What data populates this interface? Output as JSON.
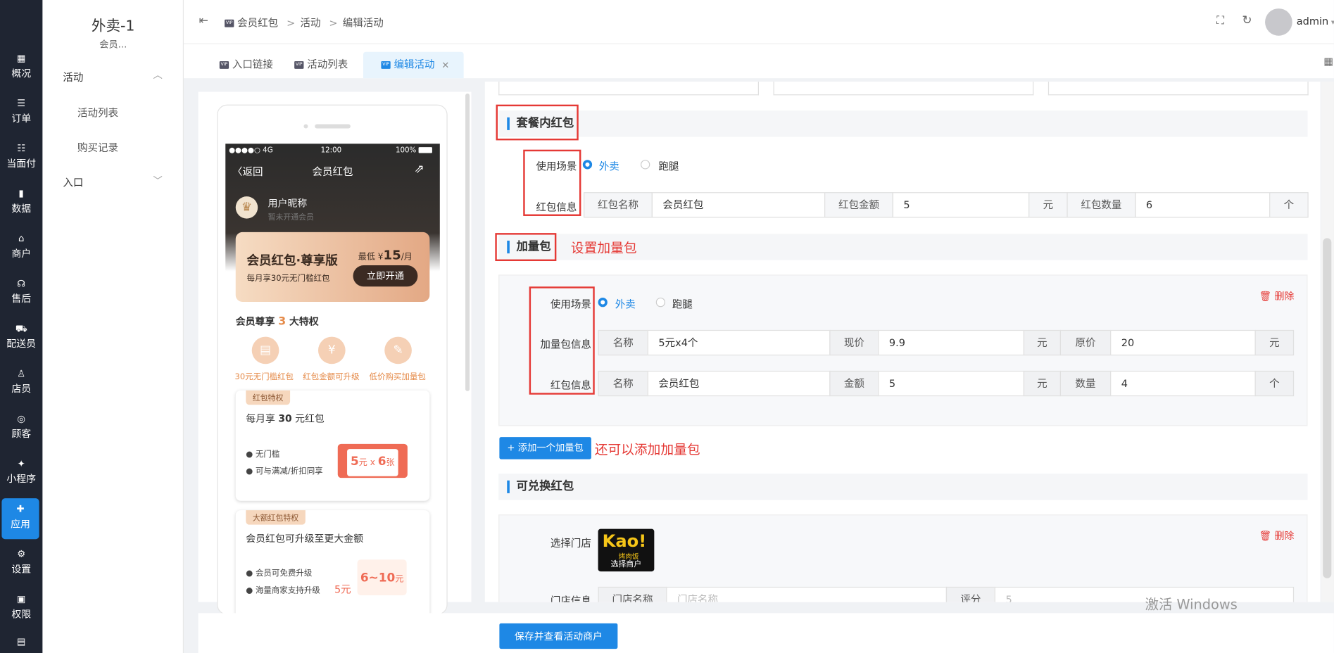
{
  "app": {
    "title": "外卖-1",
    "subtitle": "会员..."
  },
  "rail": [
    {
      "label": "概况",
      "icon": "▦"
    },
    {
      "label": "订单",
      "icon": "☰"
    },
    {
      "label": "当面付",
      "icon": "☷"
    },
    {
      "label": "数据",
      "icon": "▮"
    },
    {
      "label": "商户",
      "icon": "⌂"
    },
    {
      "label": "售后",
      "icon": "☊"
    },
    {
      "label": "配送员",
      "icon": "⛟"
    },
    {
      "label": "店员",
      "icon": "♙"
    },
    {
      "label": "顾客",
      "icon": "◎"
    },
    {
      "label": "小程序",
      "icon": "✦"
    },
    {
      "label": "应用",
      "icon": "✚"
    },
    {
      "label": "设置",
      "icon": "⚙"
    },
    {
      "label": "权限",
      "icon": "▣"
    },
    {
      "label": "",
      "icon": "▤"
    }
  ],
  "menu": {
    "group1": "活动",
    "item1": "活动列表",
    "item2": "购买记录",
    "group2": "入口"
  },
  "breadcrumb": {
    "a": "会员红包",
    "sep1": ">",
    "b": "活动",
    "sep2": ">",
    "c": "编辑活动"
  },
  "user": "admin",
  "tabs": [
    {
      "label": "入口链接"
    },
    {
      "label": "活动列表"
    },
    {
      "label": "编辑活动",
      "close": "×"
    }
  ],
  "phone": {
    "carrier": "●●●●○ 4G",
    "time": "12:00",
    "battery": "100%",
    "back": "返回",
    "title": "会员红包",
    "nickname": "用户昵称",
    "member_status": "暂未开通会员",
    "card_title": "会员红包·尊享版",
    "card_sub": "每月享30元无门槛红包",
    "price_prefix": "最低 ¥",
    "price": "15",
    "price_unit": "/月",
    "open_btn": "立即开通",
    "priv_title_a": "会员尊享",
    "priv_num": "3",
    "priv_title_b": "大特权",
    "privs": [
      "30元无门槛红包",
      "红包金额可升级",
      "低价购买加量包"
    ],
    "card1_tag": "红包特权",
    "card1_title_a": "每月享 ",
    "card1_num": "30",
    "card1_title_b": " 元红包",
    "card1_b1": "无门槛",
    "card1_b2": "可与满减/折扣同享",
    "coupon_a": "5",
    "coupon_u": "元",
    "coupon_x": "x",
    "coupon_b": "6",
    "coupon_u2": "张",
    "card2_tag": "大额红包特权",
    "card2_title": "会员红包可升级至更大金额",
    "card2_b1": "会员可免费升级",
    "card2_b2": "海量商家支持升级",
    "card2_small": "5元",
    "card2_big_a": "6~10",
    "card2_big_u": "元"
  },
  "section1": {
    "title": "套餐内红包",
    "scene_label": "使用场景",
    "opt1": "外卖",
    "opt2": "跑腿",
    "info_label": "红包信息",
    "name_l": "红包名称",
    "name_v": "会员红包",
    "amt_l": "红包金额",
    "amt_v": "5",
    "amt_u": "元",
    "qty_l": "红包数量",
    "qty_v": "6",
    "qty_u": "个"
  },
  "section2": {
    "title": "加量包",
    "annotation": "设置加量包",
    "scene_label": "使用场景",
    "opt1": "外卖",
    "opt2": "跑腿",
    "delete": "删除",
    "pkg_label": "加量包信息",
    "pkg_name_l": "名称",
    "pkg_name_v": "5元x4个",
    "pkg_price_l": "现价",
    "pkg_price_v": "9.9",
    "pkg_price_u": "元",
    "pkg_orig_l": "原价",
    "pkg_orig_v": "20",
    "pkg_orig_u": "元",
    "rp_label": "红包信息",
    "rp_name_l": "名称",
    "rp_name_v": "会员红包",
    "rp_amt_l": "金额",
    "rp_amt_v": "5",
    "rp_amt_u": "元",
    "rp_qty_l": "数量",
    "rp_qty_v": "4",
    "rp_qty_u": "个",
    "add_btn": "+ 添加一个加量包",
    "add_annotation": "还可以添加加量包"
  },
  "section3": {
    "title": "可兑换红包",
    "store_label": "选择门店",
    "logo_text": "Kao!",
    "logo_sub": "烤肉饭",
    "logo_overlay": "选择商户",
    "delete": "删除",
    "info_label": "门店信息",
    "store_name_l": "门店名称",
    "store_name_ph": "门店名称",
    "score_l": "评分",
    "score_v": "5"
  },
  "save_btn": "保存并查看活动商户",
  "watermark": "激活 Windows",
  "colors": {
    "primary": "#1e88e5",
    "danger": "#e53935",
    "rail": "#1f2532"
  }
}
